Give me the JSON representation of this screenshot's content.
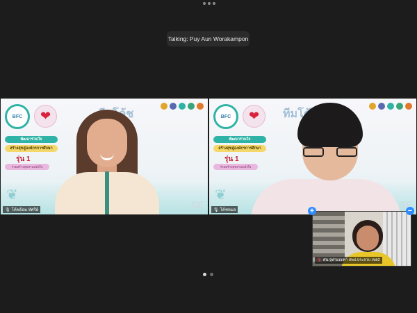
{
  "top_menu": {
    "icon": "more-dots-icon"
  },
  "talking_indicator": {
    "text": "Talking: Puy Aun Worakampon"
  },
  "tiles": {
    "left": {
      "bg_title": "ทีมโค้ช",
      "teal_pill": "พัฒนาร่วมใจ",
      "yellow_pill": "สร้างสุขสู่องค์กรการศึกษา",
      "batch": "รุ่น 1",
      "pink_pill": "ร่วมสร้างสุขสานพลังใจ",
      "name": "โค้ชอ้อม ทัศรีย์",
      "logo_text": "BFC",
      "watermark": "SE"
    },
    "right": {
      "bg_title": "ทีมโค้ช",
      "teal_pill": "พัฒนาร่วมใจ",
      "yellow_pill": "สร้างสุขสู่องค์กรการศึกษา",
      "batch": "รุ่น 1",
      "pink_pill": "ร่วมสร้างสุขสานพลังใจ",
      "name": "โค้ชหมอ",
      "logo_text": "BFC",
      "watermark": "SE"
    }
  },
  "self_view": {
    "name": "ศน.จุฬามณฑา สพป.ประจวบ เขต2"
  },
  "controls": {
    "add_symbol": "+",
    "minimize_symbol": "−"
  },
  "colors": {
    "background": "#1c1c1c",
    "accent": "#2d8cff",
    "teal": "#2fb3a6"
  },
  "pagination": {
    "pages": 2,
    "current": 1
  }
}
